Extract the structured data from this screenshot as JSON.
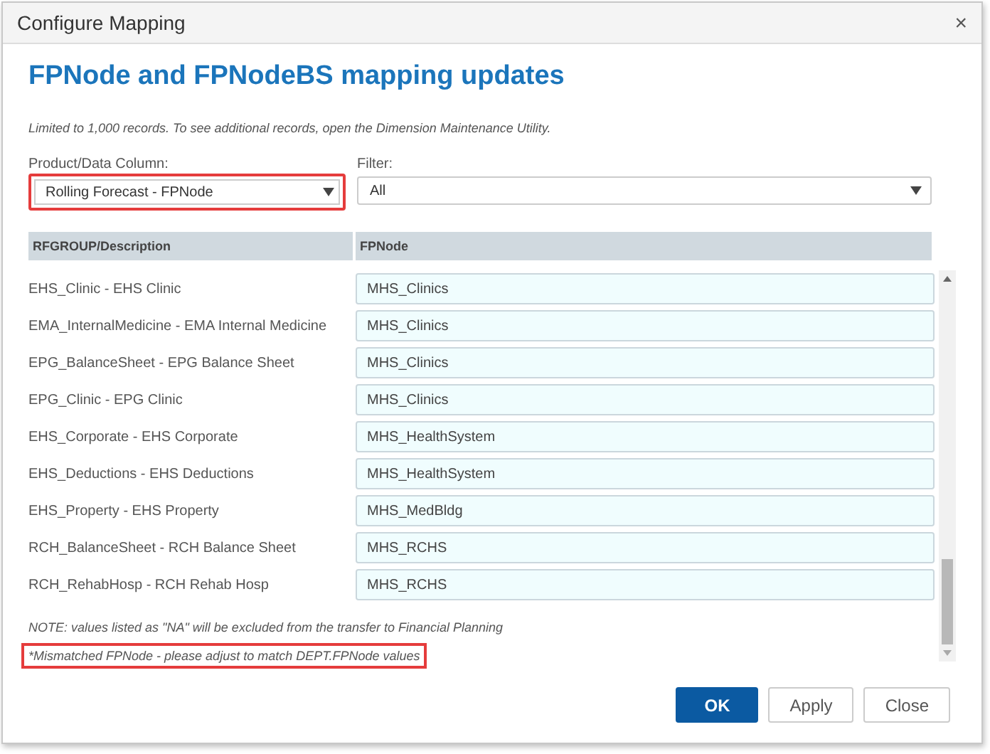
{
  "window": {
    "title": "Configure Mapping",
    "close": "×"
  },
  "heading": "FPNode and FPNodeBS mapping updates",
  "info": "Limited to 1,000 records. To see additional records, open the Dimension Maintenance Utility.",
  "product_column": {
    "label": "Product/Data Column:",
    "value": "Rolling Forecast - FPNode",
    "highlighted": true
  },
  "filter": {
    "label": "Filter:",
    "value": "All",
    "highlighted": false
  },
  "table": {
    "columns": [
      "RFGROUP/Description",
      "FPNode"
    ],
    "rows": [
      {
        "description": "EHS_Clinic - EHS Clinic",
        "fpnode": "MHS_Clinics"
      },
      {
        "description": "EMA_InternalMedicine - EMA Internal Medicine",
        "fpnode": "MHS_Clinics"
      },
      {
        "description": "EPG_BalanceSheet - EPG Balance Sheet",
        "fpnode": "MHS_Clinics"
      },
      {
        "description": "EPG_Clinic - EPG Clinic",
        "fpnode": "MHS_Clinics"
      },
      {
        "description": "EHS_Corporate - EHS Corporate",
        "fpnode": "MHS_HealthSystem"
      },
      {
        "description": "EHS_Deductions - EHS Deductions",
        "fpnode": "MHS_HealthSystem"
      },
      {
        "description": "EHS_Property - EHS Property",
        "fpnode": "MHS_MedBldg"
      },
      {
        "description": "RCH_BalanceSheet - RCH Balance Sheet",
        "fpnode": "MHS_RCHS"
      },
      {
        "description": "RCH_RehabHosp - RCH Rehab Hosp",
        "fpnode": "MHS_RCHS"
      }
    ]
  },
  "notes": [
    {
      "text": "NOTE: values listed as \"NA\" will be excluded from the transfer to Financial Planning",
      "highlighted": false
    },
    {
      "text": "*Mismatched FPNode - please adjust to match DEPT.FPNode values",
      "highlighted": true
    }
  ],
  "buttons": [
    {
      "label": "OK",
      "kind": "primary"
    },
    {
      "label": "Apply",
      "kind": "secondary"
    },
    {
      "label": "Close",
      "kind": "secondary"
    }
  ]
}
